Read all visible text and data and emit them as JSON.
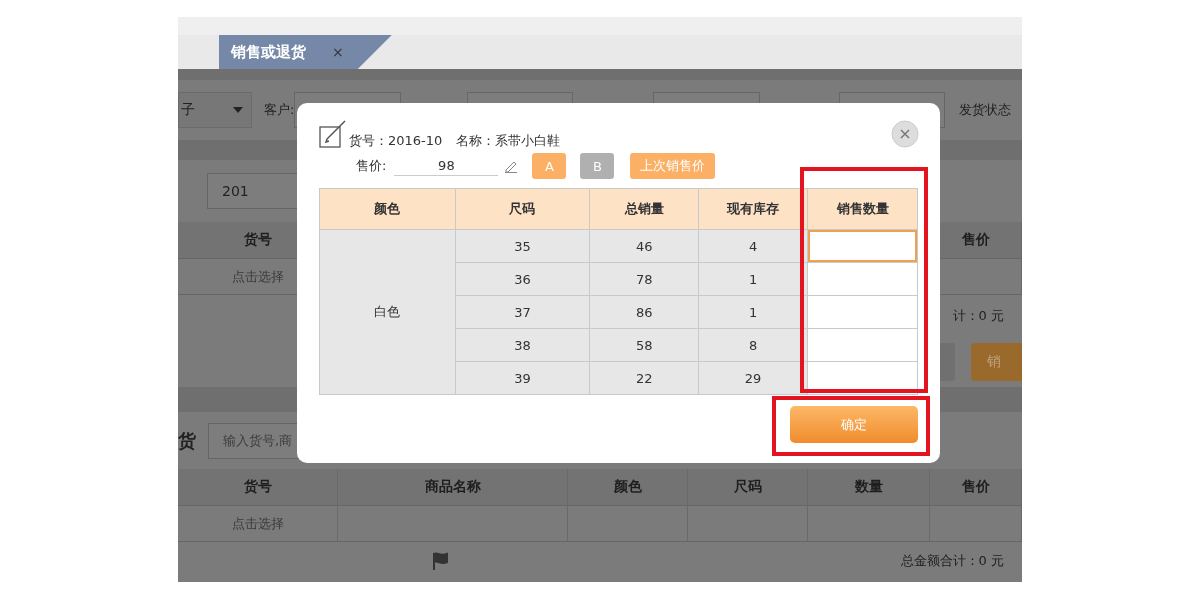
{
  "tab": {
    "label": "销售或退货",
    "close": "×",
    "selected": true
  },
  "filter_bar": {
    "select_value": "子",
    "customer_label": "客户:",
    "shipping_status_label": "发货状态"
  },
  "code_field": {
    "value": "201"
  },
  "top_table": {
    "columns": [
      "货号",
      "售价"
    ],
    "rows": [
      [
        "点击选择"
      ]
    ],
    "subtotal": "计：0 元",
    "button_label": "销"
  },
  "search": {
    "label": "货",
    "placeholder": "输入货号,商"
  },
  "bottom_table": {
    "columns": [
      "货号",
      "商品名称",
      "颜色",
      "尺码",
      "数量",
      "售价"
    ],
    "rows": [
      [
        "点击选择"
      ]
    ],
    "total": "总金额合计：0 元"
  },
  "dialog": {
    "item_code_label": "货号：",
    "item_code": "2016-10",
    "name_label": "名称：",
    "name": "系带小白鞋",
    "price_label": "售价:",
    "price": "98",
    "price_buttons": [
      {
        "label": "A",
        "disabled": false
      },
      {
        "label": "B",
        "disabled": true
      },
      {
        "label": "上次销售价",
        "disabled": false
      }
    ],
    "columns": [
      "颜色",
      "尺码",
      "总销量",
      "现有库存",
      "销售数量"
    ],
    "quantity_column_highlighted": true,
    "groups": [
      {
        "name": "白色",
        "rows": [
          {
            "size": "35",
            "total_sales": "46",
            "stock": "4",
            "focused": true
          },
          {
            "size": "36",
            "total_sales": "78",
            "stock": "1",
            "focused": false
          },
          {
            "size": "37",
            "total_sales": "86",
            "stock": "1",
            "focused": false
          },
          {
            "size": "38",
            "total_sales": "58",
            "stock": "8",
            "focused": false
          },
          {
            "size": "39",
            "total_sales": "22",
            "stock": "29",
            "focused": false
          }
        ]
      }
    ],
    "ok": {
      "label": "确定",
      "highlighted": true
    }
  }
}
